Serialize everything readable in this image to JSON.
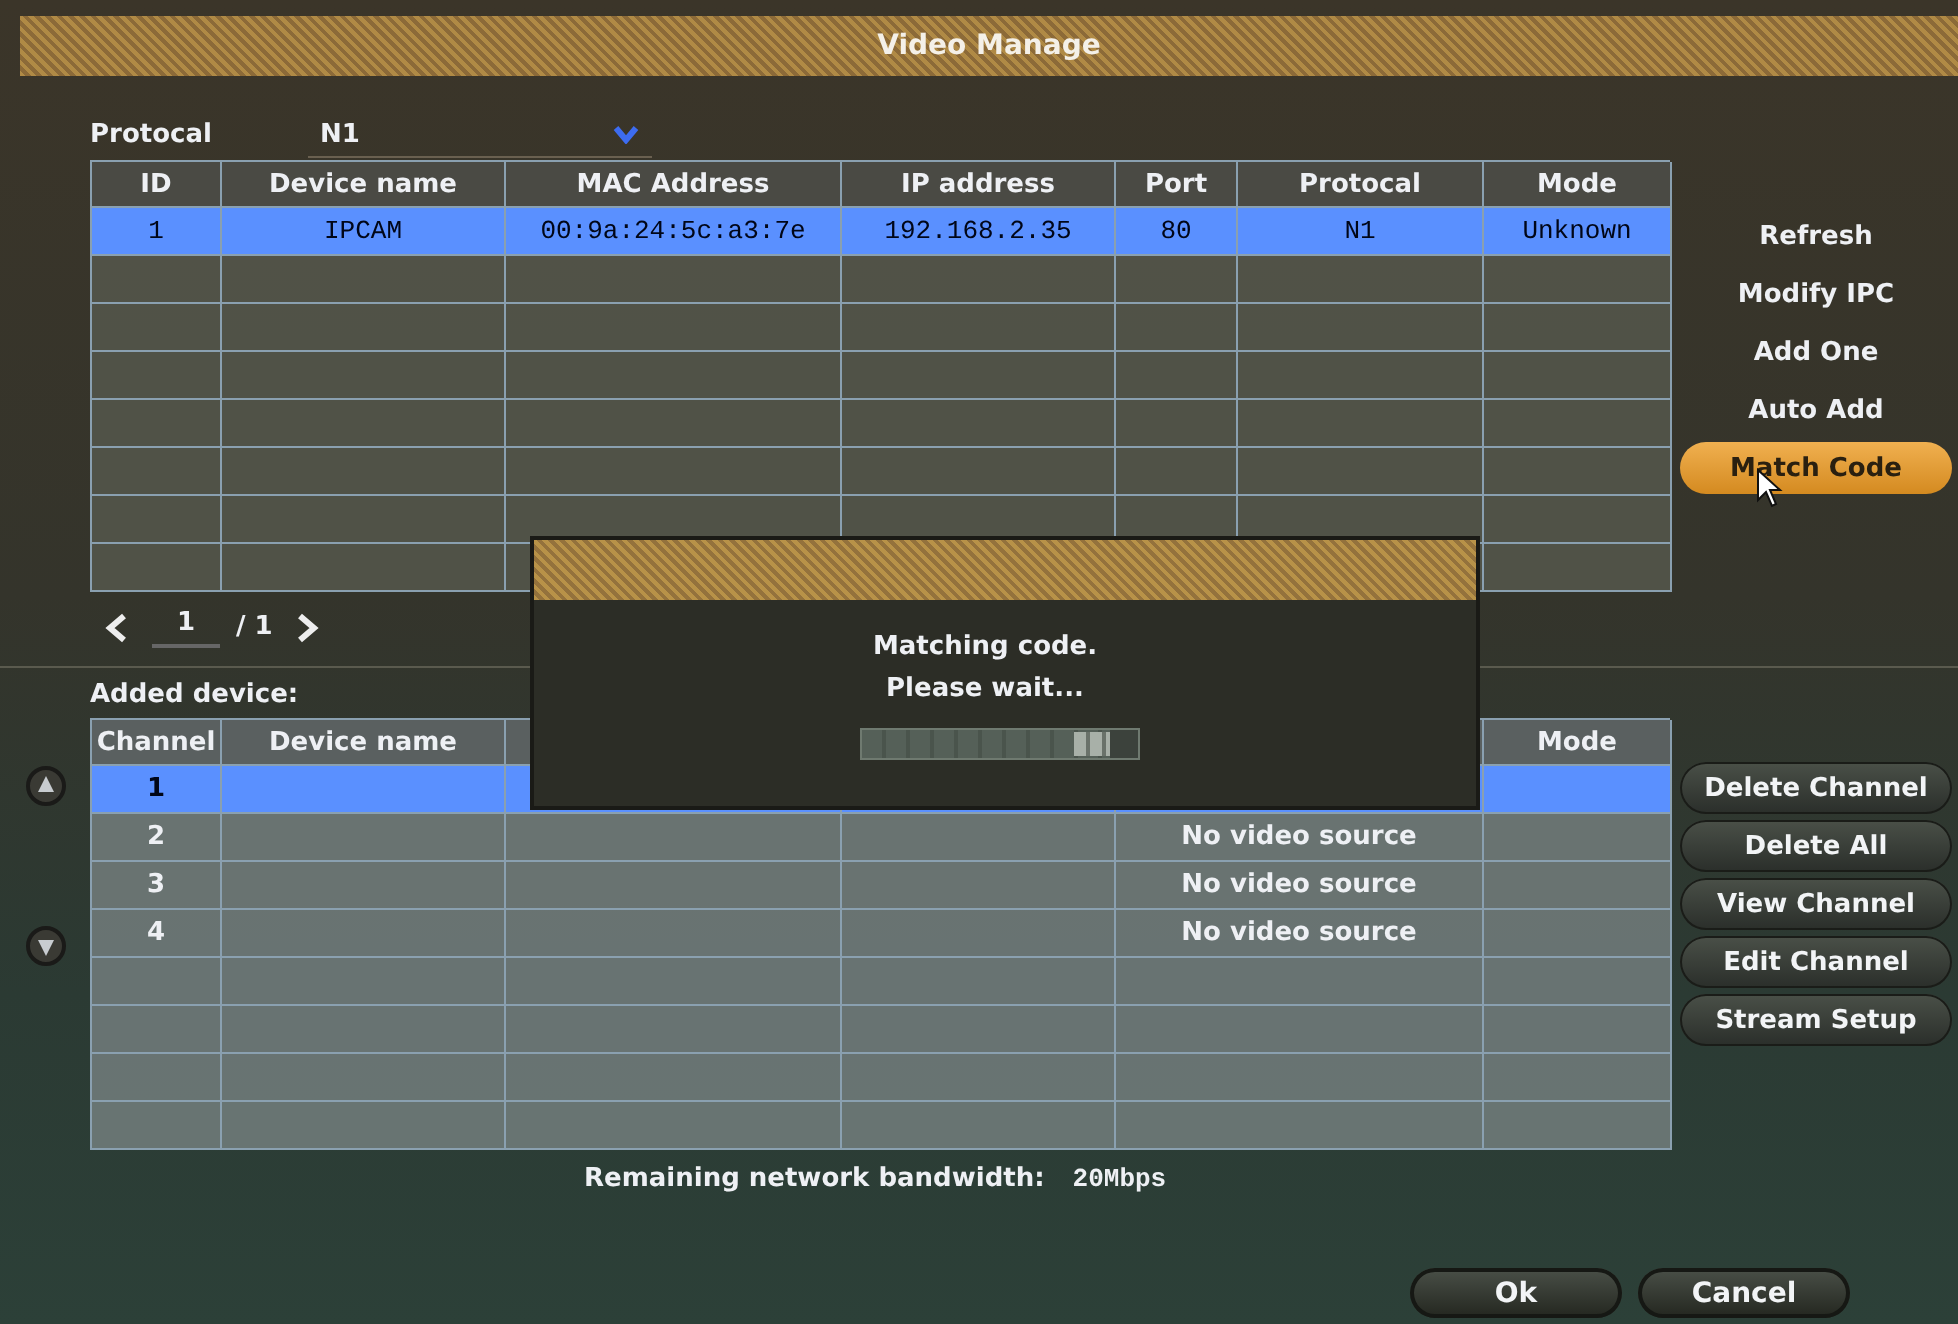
{
  "window": {
    "title": "Video Manage"
  },
  "protocol_filter": {
    "label": "Protocal",
    "value": "N1"
  },
  "search_results": {
    "columns": [
      "ID",
      "Device name",
      "MAC Address",
      "IP address",
      "Port",
      "Protocal",
      "Mode"
    ],
    "rows": [
      {
        "cells": [
          "1",
          "IPCAM",
          "00:9a:24:5c:a3:7e",
          "192.168.2.35",
          "80",
          "N1",
          "Unknown"
        ],
        "selected": true
      }
    ]
  },
  "pager": {
    "current": "1",
    "separator": "/ 1"
  },
  "search_buttons": [
    {
      "label": "Refresh",
      "selected": false
    },
    {
      "label": "Modify IPC",
      "selected": false
    },
    {
      "label": "Add One",
      "selected": false
    },
    {
      "label": "Auto Add",
      "selected": false
    },
    {
      "label": "Match Code",
      "selected": true
    }
  ],
  "added_devices": {
    "title": "Added device:",
    "columns": {
      "channel": "Channel",
      "device_name": "Device name",
      "mode": "Mode"
    },
    "rows": [
      {
        "channel": "1",
        "selected": true
      },
      {
        "channel": "2",
        "column_5": "No video source",
        "selected": false
      },
      {
        "channel": "3",
        "column_5": "No video source",
        "selected": false
      },
      {
        "channel": "4",
        "column_5": "No video source",
        "selected": false
      }
    ]
  },
  "channel_buttons": [
    {
      "label": "Delete Channel",
      "selected": false
    },
    {
      "label": "Delete All",
      "selected": false
    },
    {
      "label": "View Channel",
      "selected": false
    },
    {
      "label": "Edit Channel",
      "selected": false
    },
    {
      "label": "Stream Setup",
      "selected": false
    }
  ],
  "bandwidth": {
    "label": "Remaining network bandwidth:",
    "value": "20Mbps"
  },
  "footer_buttons": [
    "Ok",
    "Cancel"
  ],
  "dialog": {
    "lines": [
      "Matching code.",
      "Please wait..."
    ],
    "progress": {
      "level": 0.9
    }
  }
}
